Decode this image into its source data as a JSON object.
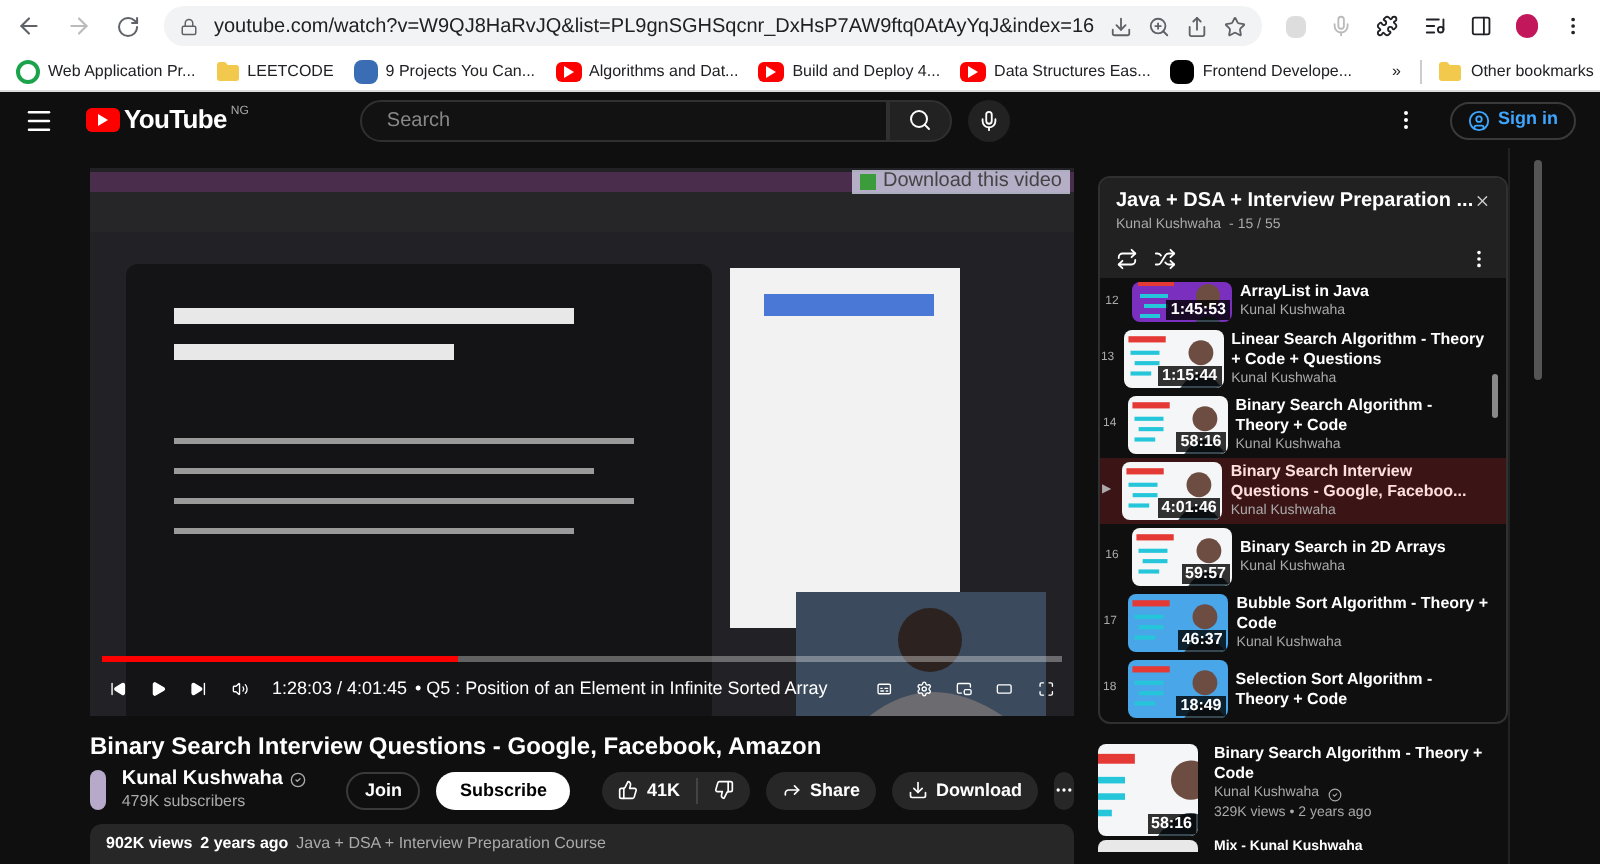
{
  "browser": {
    "url": "youtube.com/watch?v=W9QJ8HaRvJQ&list=PL9gnSGHSqcnr_DxHsP7AW9ftq0AtAyYqJ&index=16",
    "bookmarks": [
      {
        "kind": "web",
        "label": "Web Application Pr..."
      },
      {
        "kind": "folder",
        "label": "LEETCODE"
      },
      {
        "kind": "app",
        "label": "9 Projects You Can..."
      },
      {
        "kind": "video",
        "label": "Algorithms and Dat..."
      },
      {
        "kind": "video",
        "label": "Build and Deploy 4..."
      },
      {
        "kind": "video",
        "label": "Data Structures Eas..."
      },
      {
        "kind": "dark",
        "label": "Frontend Develope..."
      }
    ],
    "more": "»",
    "other_bookmarks": "Other bookmarks"
  },
  "header": {
    "logo": "YouTube",
    "region": "NG",
    "search_placeholder": "Search",
    "sign_in": "Sign in"
  },
  "player": {
    "overlay": "Download this video",
    "level": 0.37,
    "time": "1:28:03 / 4:01:45",
    "chapter": "• Q5 : Position of an Element in Infinite Sorted Array"
  },
  "video": {
    "title": "Binary Search Interview Questions - Google, Facebook, Amazon",
    "channel": "Kunal Kushwaha",
    "subscribers": "479K subscribers",
    "join": "Join",
    "subscribe": "Subscribe",
    "likes": "41K",
    "share": "Share",
    "download": "Download",
    "views": "902K views",
    "age": "2 years ago",
    "playlist": "Java + DSA + Interview Preparation Course"
  },
  "playlist": {
    "title": "Java + DSA + Interview Preparation ...",
    "channel": "Kunal Kushwaha",
    "position": "- 15 / 55",
    "items": [
      {
        "index": "12",
        "title": "ArrayList in Java",
        "channel": "Kunal Kushwaha",
        "duration": "1:45:53",
        "selected": false
      },
      {
        "index": "13",
        "title": "Linear Search Algorithm - Theory + Code + Questions",
        "channel": "Kunal Kushwaha",
        "duration": "1:15:44",
        "selected": false
      },
      {
        "index": "14",
        "title": "Binary Search Algorithm - Theory + Code",
        "channel": "Kunal Kushwaha",
        "duration": "58:16",
        "selected": false
      },
      {
        "index": "▶",
        "title": "Binary Search Interview Questions - Google, Faceboo...",
        "channel": "Kunal Kushwaha",
        "duration": "4:01:46",
        "selected": true
      },
      {
        "index": "16",
        "title": "Binary Search in 2D Arrays",
        "channel": "Kunal Kushwaha",
        "duration": "59:57",
        "selected": false
      },
      {
        "index": "17",
        "title": "Bubble Sort Algorithm - Theory + Code",
        "channel": "Kunal Kushwaha",
        "duration": "46:37",
        "selected": false
      },
      {
        "index": "18",
        "title": "Selection Sort Algorithm - Theory + Code",
        "duration": "18:49",
        "selected": false
      }
    ]
  },
  "recommendations": [
    {
      "title": "Binary Search Algorithm - Theory + Code",
      "channel": "Kunal Kushwaha",
      "meta": "329K views • 2 years ago",
      "duration": "58:16"
    },
    {
      "title": "Mix - Kunal Kushwaha"
    }
  ]
}
